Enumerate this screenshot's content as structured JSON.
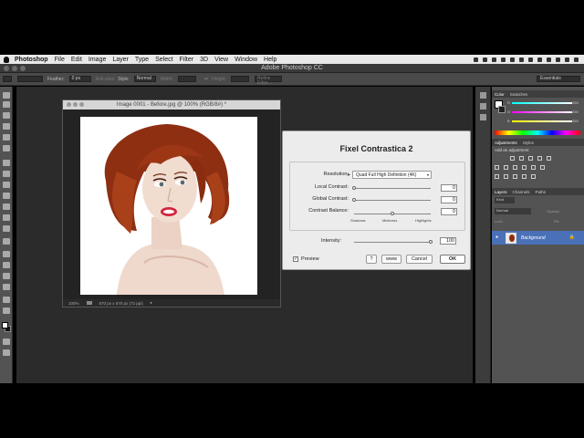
{
  "menubar": {
    "app": "Photoshop",
    "items": [
      "File",
      "Edit",
      "Image",
      "Layer",
      "Type",
      "Select",
      "Filter",
      "3D",
      "View",
      "Window",
      "Help"
    ]
  },
  "window": {
    "title": "Adobe Photoshop CC"
  },
  "options_bar": {
    "feather_label": "Feather:",
    "feather_value": "0 px",
    "antialias": "Anti-alias",
    "style_label": "Style:",
    "style_value": "Normal",
    "width_label": "Width:",
    "height_label": "Height:",
    "refine": "Refine Edge...",
    "workspace": "Essentials"
  },
  "document": {
    "title": "Image 0001 - Before.jpg @ 100% (RGB/8#) *",
    "zoom": "100%",
    "size": "670 px x 670 px (72 ppi)"
  },
  "dialog": {
    "title": "Fixel Contrastica 2",
    "resolution_label": "Resolution:",
    "resolution_value": "Quad Full High Definition (4K)",
    "local_label": "Local Contrast:",
    "local_value": "0",
    "global_label": "Global Contrast:",
    "global_value": "0",
    "balance_label": "Contrast Balance:",
    "balance_value": "0",
    "shadows": "Shadows",
    "midtones": "Midtones",
    "highlights": "Highlights",
    "intensity_label": "Intensity:",
    "intensity_value": "100",
    "intensity_level": 1.0,
    "local_level": 0.0,
    "global_level": 0.0,
    "balance_level": 0.5,
    "preview_label": "Preview",
    "preview_checked": true,
    "help_label": "?",
    "www_label": "www",
    "cancel_label": "Cancel",
    "ok_label": "OK"
  },
  "color_panel": {
    "tabs": [
      "Color",
      "Swatches"
    ],
    "channels": [
      {
        "label": "R",
        "value": "255",
        "color": "#ff3030"
      },
      {
        "label": "G",
        "value": "255",
        "color": "#30ff30"
      },
      {
        "label": "B",
        "value": "255",
        "color": "#3060ff"
      }
    ]
  },
  "adjustments_panel": {
    "tabs": [
      "Adjustments",
      "Styles"
    ],
    "heading": "Add an adjustment"
  },
  "layers_panel": {
    "tabs": [
      "Layers",
      "Channels",
      "Paths"
    ],
    "kind": "Kind",
    "blend": "Normal",
    "opacity_label": "Opacity:",
    "lock_label": "Lock:",
    "fill_label": "Fill:",
    "layer_name": "Background"
  },
  "colors": {
    "workspace": "#2b2b2b",
    "panel": "#535353",
    "selected_layer": "#4a71b8",
    "dialog_bg": "#ececec"
  }
}
